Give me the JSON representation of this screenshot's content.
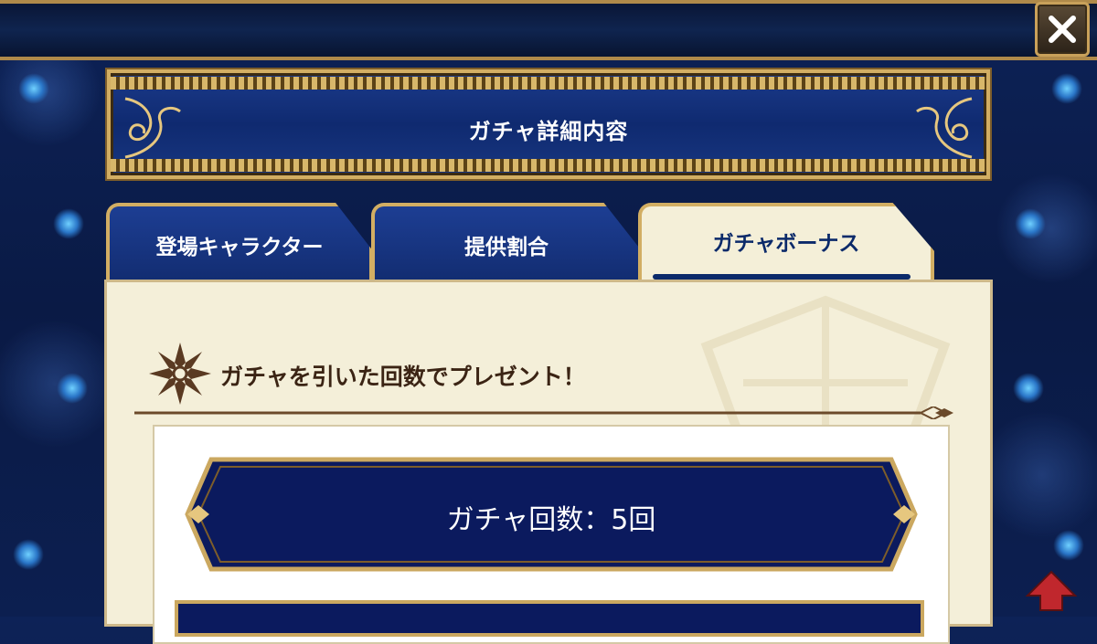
{
  "header": {
    "close_icon": "close-x-icon"
  },
  "title_banner": {
    "title": "ガチャ詳細内容"
  },
  "tabs": [
    {
      "label": "登場キャラクター",
      "active": false
    },
    {
      "label": "提供割合",
      "active": false
    },
    {
      "label": "ガチャボーナス",
      "active": true
    }
  ],
  "bonus_panel": {
    "section_title": "ガチャを引いた回数でプレゼント！",
    "emblem_icon": "snowflake-emblem-icon",
    "count_label": "ガチャ回数：5回"
  },
  "colors": {
    "gold": "#d2ae63",
    "navy": "#0b1a5e",
    "parchment": "#f4efd9",
    "scroll_arrow": "#c0272d"
  }
}
